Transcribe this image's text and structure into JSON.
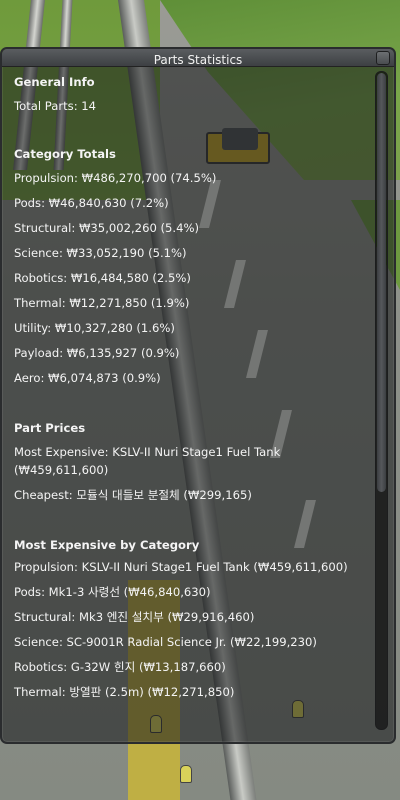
{
  "window": {
    "title": "Parts Statistics"
  },
  "general": {
    "heading": "General Info",
    "total_parts": "Total Parts: 14"
  },
  "category_totals": {
    "heading": "Category Totals",
    "items": [
      "Propulsion: ₩486,270,700 (74.5%)",
      "Pods: ₩46,840,630 (7.2%)",
      "Structural: ₩35,002,260 (5.4%)",
      "Science: ₩33,052,190 (5.1%)",
      "Robotics: ₩16,484,580 (2.5%)",
      "Thermal: ₩12,271,850 (1.9%)",
      "Utility: ₩10,327,280 (1.6%)",
      "Payload: ₩6,135,927 (0.9%)",
      "Aero: ₩6,074,873 (0.9%)"
    ]
  },
  "part_prices": {
    "heading": "Part Prices",
    "most_expensive": "Most Expensive: KSLV-II Nuri Stage1 Fuel Tank (₩459,611,600)",
    "cheapest": "Cheapest: 모듈식 대들보 분절체 (₩299,165)"
  },
  "most_expensive_by_category": {
    "heading": "Most Expensive by Category",
    "items": [
      "Propulsion: KSLV-II Nuri Stage1 Fuel Tank (₩459,611,600)",
      "Pods: Mk1-3 사령선 (₩46,840,630)",
      "Structural: Mk3 엔진 설치부 (₩29,916,460)",
      "Science: SC-9001R Radial Science Jr. (₩22,199,230)",
      "Robotics: G-32W 힌지 (₩13,187,660)",
      "Thermal: 방열판 (2.5m) (₩12,271,850)"
    ]
  },
  "scrollbar": {
    "visible_fraction": 0.64
  }
}
